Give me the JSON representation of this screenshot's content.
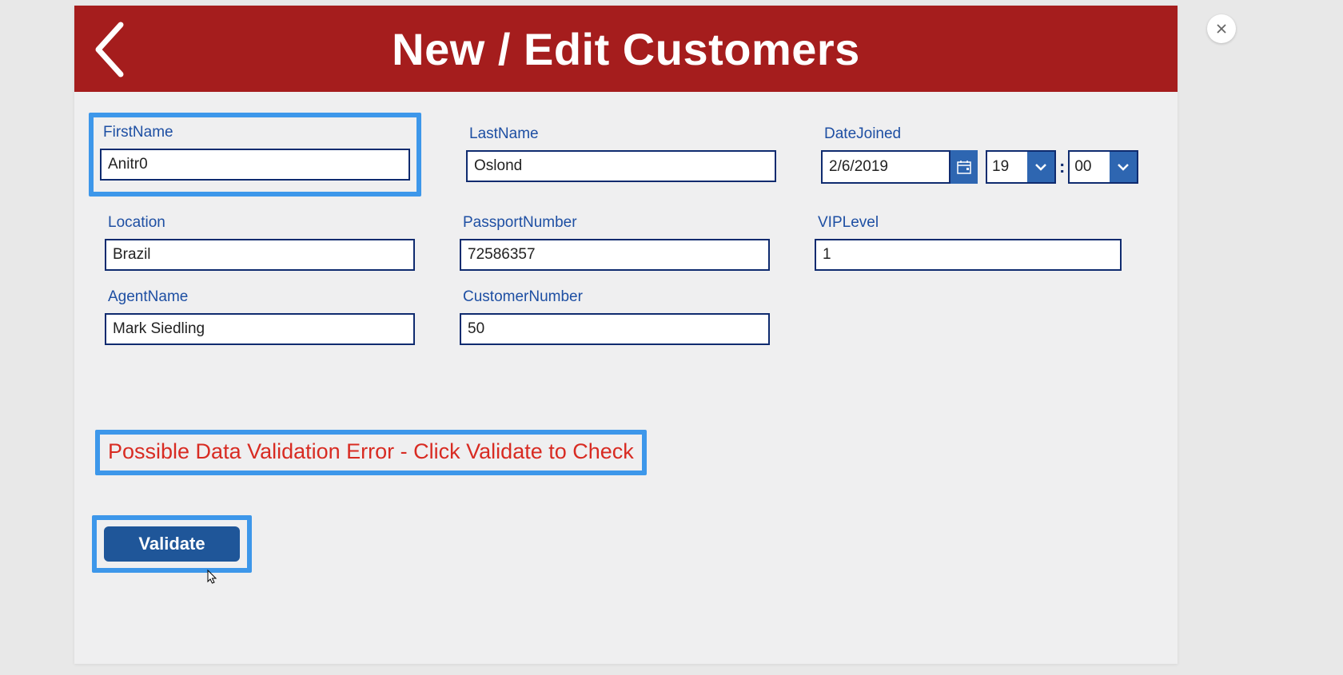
{
  "header": {
    "title": "New / Edit Customers"
  },
  "fields": {
    "firstName": {
      "label": "FirstName",
      "value": "Anitr0"
    },
    "lastName": {
      "label": "LastName",
      "value": "Oslond"
    },
    "dateJoined": {
      "label": "DateJoined",
      "date": "2/6/2019",
      "hour": "19",
      "minute": "00"
    },
    "location": {
      "label": "Location",
      "value": "Brazil"
    },
    "passportNumber": {
      "label": "PassportNumber",
      "value": "72586357"
    },
    "vipLevel": {
      "label": "VIPLevel",
      "value": "1"
    },
    "agentName": {
      "label": "AgentName",
      "value": "Mark Siedling"
    },
    "customerNumber": {
      "label": "CustomerNumber",
      "value": "50"
    }
  },
  "validation": {
    "message": "Possible Data Validation Error - Click Validate to Check",
    "buttonLabel": "Validate"
  },
  "timeColon": ":"
}
